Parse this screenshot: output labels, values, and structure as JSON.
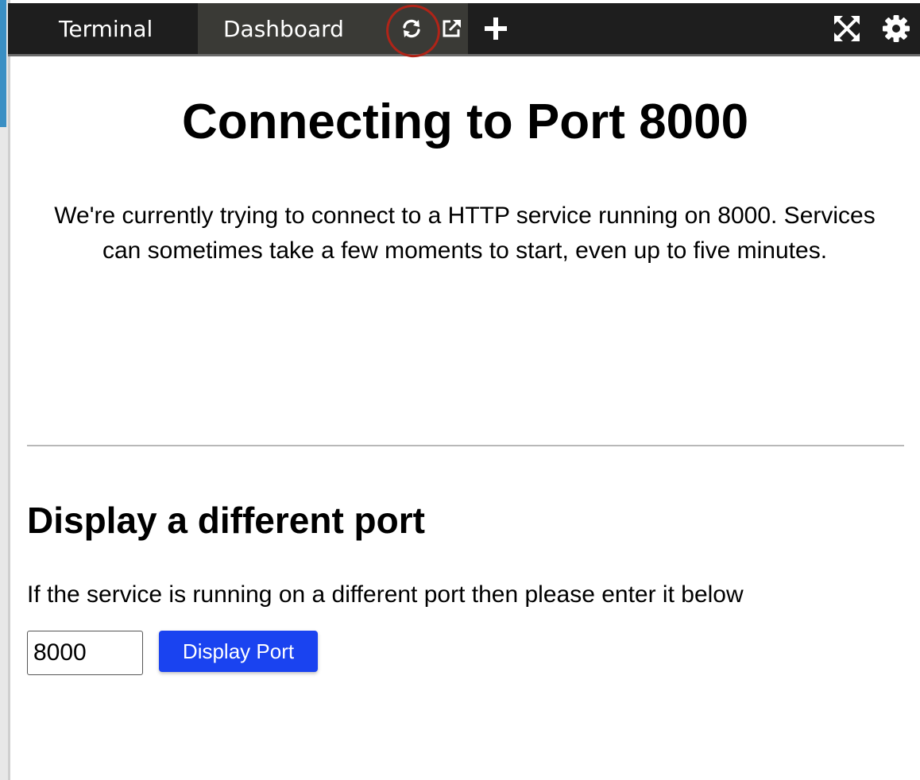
{
  "tabs": [
    {
      "label": "Terminal"
    },
    {
      "label": "Dashboard"
    }
  ],
  "toolbar": {
    "icons": [
      "refresh-icon",
      "external-link-icon",
      "plus-icon",
      "expand-icon",
      "gear-icon"
    ]
  },
  "main": {
    "title": "Connecting to Port 8000",
    "intro": "We're currently trying to connect to a HTTP service running on 8000. Services can sometimes take a few moments to start, even up to five minutes."
  },
  "port_section": {
    "heading": "Display a different port",
    "help": "If the service is running on a different port then please enter it below",
    "input_value": "8000",
    "button_label": "Display Port"
  },
  "colors": {
    "tabbar_bg": "#1e1e1e",
    "active_tab_bg": "#3a3a36",
    "button_bg": "#1a43f0",
    "annotation": "#b02418"
  }
}
